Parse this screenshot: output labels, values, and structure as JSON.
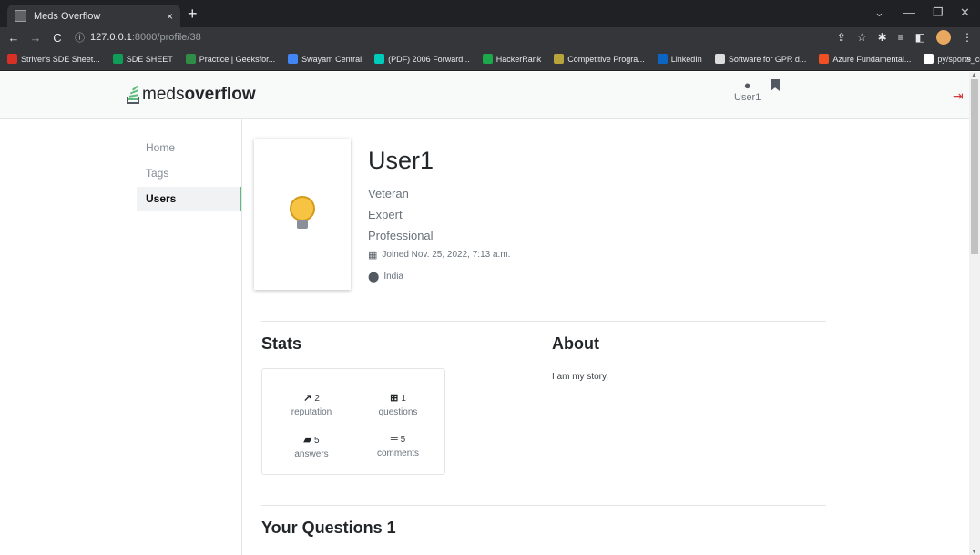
{
  "browser": {
    "tab_title": "Meds Overflow",
    "tab_close": "×",
    "new_tab": "+",
    "url_host": "127.0.0.1",
    "url_path": ":8000/profile/38",
    "bookmarks": [
      {
        "label": "Striver's SDE Sheet...",
        "color": "#d93025"
      },
      {
        "label": "SDE SHEET",
        "color": "#0f9d58"
      },
      {
        "label": "Practice | Geeksfor...",
        "color": "#2f8d46"
      },
      {
        "label": "Swayam Central",
        "color": "#4285f4"
      },
      {
        "label": "(PDF) 2006 Forward...",
        "color": "#00ccbb"
      },
      {
        "label": "HackerRank",
        "color": "#1ba94c"
      },
      {
        "label": "Competitive Progra...",
        "color": "#b7a43a"
      },
      {
        "label": "LinkedIn",
        "color": "#0a66c2"
      },
      {
        "label": "Software for GPR d...",
        "color": "#dddddd"
      },
      {
        "label": "Azure Fundamental...",
        "color": "#f25022"
      },
      {
        "label": "py/sports_celebrity_...",
        "color": "#ffffff"
      }
    ],
    "bookmarks_more": "»"
  },
  "header": {
    "logo_light": "meds",
    "logo_bold": "overflow",
    "user_label": "User1"
  },
  "sidebar": {
    "items": [
      {
        "label": "Home"
      },
      {
        "label": "Tags"
      },
      {
        "label": "Users"
      }
    ]
  },
  "profile": {
    "name": "User1",
    "badges": [
      "Veteran",
      "Expert",
      "Professional"
    ],
    "joined": "Joined Nov. 25, 2022, 7:13 a.m.",
    "location": "India"
  },
  "stats": {
    "title": "Stats",
    "reputation_value": "2",
    "reputation_label": "reputation",
    "questions_value": "1",
    "questions_label": "questions",
    "answers_value": "5",
    "answers_label": "answers",
    "comments_value": "5",
    "comments_label": "comments"
  },
  "about": {
    "title": "About",
    "text": "I am my story."
  },
  "questions": {
    "title": "Your Questions 1"
  },
  "colors": {
    "accent_green": "#5eba7d",
    "logout_red": "#d0393e"
  }
}
